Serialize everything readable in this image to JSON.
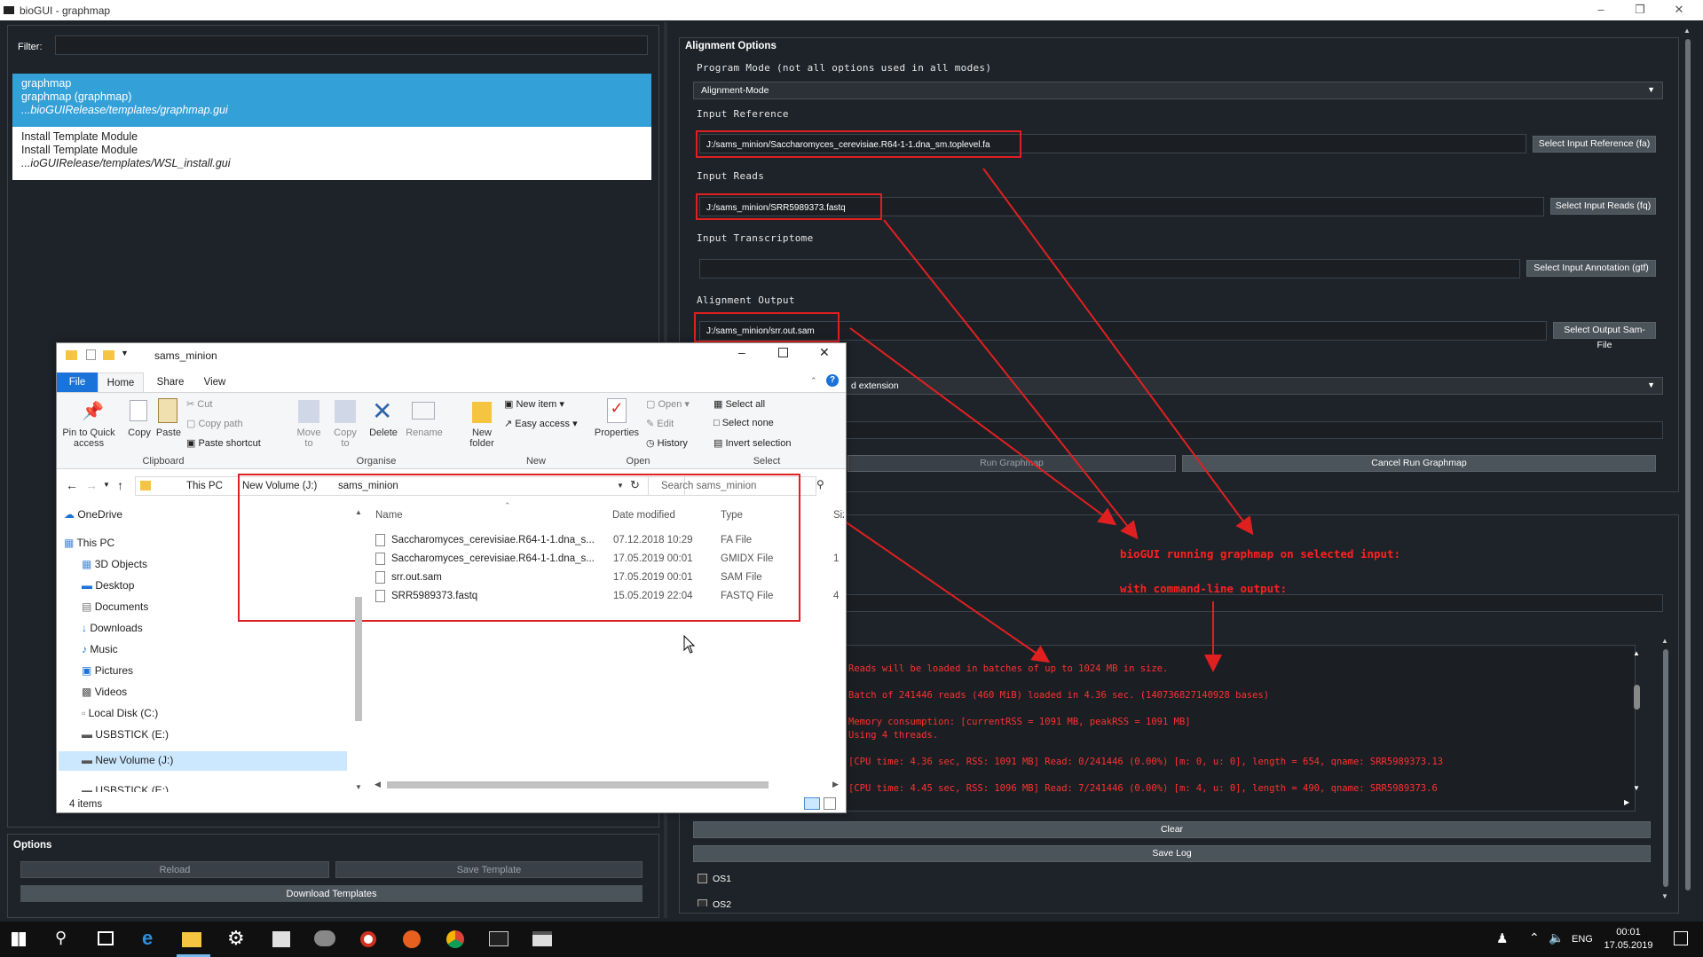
{
  "window": {
    "title": "bioGUI - graphmap"
  },
  "left": {
    "filter_label": "Filter:",
    "templates": [
      {
        "name": "graphmap",
        "title": "graphmap (graphmap)",
        "path": "...bioGUIRelease/templates/graphmap.gui"
      },
      {
        "name": "Install Template Module",
        "title": "Install Template Module",
        "path": "...ioGUIRelease/templates/WSL_install.gui"
      }
    ],
    "options_title": "Options",
    "reload": "Reload",
    "save_template": "Save Template",
    "download_templates": "Download Templates"
  },
  "right": {
    "section_title": "Alignment Options",
    "program_mode_label": "Program Mode (not all options used in all modes)",
    "program_mode_value": "Alignment-Mode",
    "input_reference_label": "Input Reference",
    "input_reference_value": "J:/sams_minion/Saccharomyces_cerevisiae.R64-1-1.dna_sm.toplevel.fa",
    "input_reference_btn": "Select Input Reference (fa)",
    "input_reads_label": "Input Reads",
    "input_reads_value": "J:/sams_minion/SRR5989373.fastq",
    "input_reads_btn": "Select Input Reads (fq)",
    "input_transcriptome_label": "Input Transcriptome",
    "input_transcriptome_btn": "Select Input Annotation (gtf)",
    "alignment_output_label": "Alignment Output",
    "alignment_output_value": "J:/sams_minion/srr.out.sam",
    "alignment_output_btn": "Select Output Sam-File",
    "extension_select": "d extension",
    "run_btn": "Run Graphmap",
    "cancel_btn": "Cancel Run Graphmap",
    "annotation_line1": "bioGUI running graphmap on selected input:",
    "annotation_line2": "with command-line output:",
    "log_lines": [
      "Reads will be loaded in batches of up to 1024 MB in size.",
      "Batch of 241446 reads (460 MiB) loaded in 4.36 sec. (140736827140928 bases)",
      "Memory consumption: [currentRSS = 1091 MB, peakRSS = 1091 MB]",
      "Using 4 threads.",
      "[CPU time: 4.36 sec, RSS: 1091 MB] Read: 0/241446 (0.00%) [m: 0, u: 0], length = 654, qname: SRR5989373.13",
      "[CPU time: 4.45 sec, RSS: 1096 MB] Read: 7/241446 (0.00%) [m: 4, u: 0], length = 490, qname: SRR5989373.6"
    ],
    "clear_btn": "Clear",
    "save_log_btn": "Save Log",
    "os1": "OS1",
    "os2": "OS2"
  },
  "explorer": {
    "title": "sams_minion",
    "tabs": [
      "File",
      "Home",
      "Share",
      "View"
    ],
    "clipboard": {
      "pin": "Pin to Quick access",
      "copy": "Copy",
      "paste": "Paste",
      "cut": "Cut",
      "copy_path": "Copy path",
      "paste_shortcut": "Paste shortcut",
      "group": "Clipboard"
    },
    "organise": {
      "move": "Move to",
      "copy": "Copy to",
      "delete": "Delete",
      "rename": "Rename",
      "group": "Organise"
    },
    "new": {
      "folder": "New folder",
      "item": "New item",
      "easy": "Easy access",
      "group": "New"
    },
    "open": {
      "properties": "Properties",
      "open": "Open",
      "edit": "Edit",
      "history": "History",
      "group": "Open"
    },
    "select": {
      "all": "Select all",
      "none": "Select none",
      "invert": "Invert selection",
      "group": "Select"
    },
    "breadcrumb": [
      "This PC",
      "New Volume (J:)",
      "sams_minion"
    ],
    "search_placeholder": "Search sams_minion",
    "nav": [
      "OneDrive",
      "This PC",
      "3D Objects",
      "Desktop",
      "Documents",
      "Downloads",
      "Music",
      "Pictures",
      "Videos",
      "Local Disk (C:)",
      "USBSTICK (E:)",
      "New Volume (J:)",
      "USBSTICK (E:)"
    ],
    "columns": [
      "Name",
      "Date modified",
      "Type",
      "Siz"
    ],
    "files": [
      {
        "name": "Saccharomyces_cerevisiae.R64-1-1.dna_s...",
        "date": "07.12.2018 10:29",
        "type": "FA File",
        "size": ""
      },
      {
        "name": "Saccharomyces_cerevisiae.R64-1-1.dna_s...",
        "date": "17.05.2019 00:01",
        "type": "GMIDX File",
        "size": "1"
      },
      {
        "name": "srr.out.sam",
        "date": "17.05.2019 00:01",
        "type": "SAM File",
        "size": ""
      },
      {
        "name": "SRR5989373.fastq",
        "date": "15.05.2019 22:04",
        "type": "FASTQ File",
        "size": "4"
      }
    ],
    "status": "4 items"
  },
  "taskbar": {
    "lang": "ENG",
    "time": "00:01",
    "date": "17.05.2019"
  }
}
